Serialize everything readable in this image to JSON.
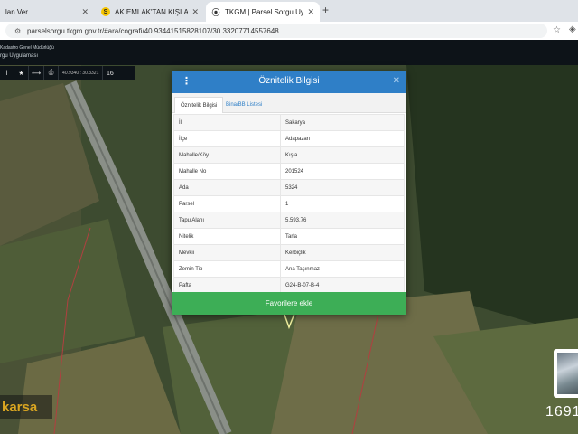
{
  "browser": {
    "tabs": [
      {
        "title": "lan Ver",
        "active": false
      },
      {
        "title": "AK EMLAK'TAN KIŞLA MAH.",
        "active": false
      },
      {
        "title": "TKGM | Parsel Sorgu Uygulam",
        "active": true
      }
    ],
    "url": "parselsorgu.tkgm.gov.tr/#ara/cografi/40.93441515828107/30.33207714557648"
  },
  "app": {
    "org_name": "Kadastro Genel Müdürlüğü",
    "app_name": "rgu Uygulaması"
  },
  "toolbar": {
    "info": "i",
    "favorite": "★",
    "measure": "⟷",
    "print": "⎙",
    "coords": "40.9340 : 30.3321",
    "zoom": "16"
  },
  "modal": {
    "title": "Öznitelik Bilgisi",
    "tabs": [
      "Öznitelik Bilgisi",
      "Bina/BB Listesi"
    ],
    "rows": [
      {
        "key": "İl",
        "value": "Sakarya"
      },
      {
        "key": "İlçe",
        "value": "Adapazarı"
      },
      {
        "key": "Mahalle/Köy",
        "value": "Kışla"
      },
      {
        "key": "Mahalle No",
        "value": "201524"
      },
      {
        "key": "Ada",
        "value": "5324"
      },
      {
        "key": "Parsel",
        "value": "1"
      },
      {
        "key": "Tapu Alanı",
        "value": "5.593,76"
      },
      {
        "key": "Nitelik",
        "value": "Tarla"
      },
      {
        "key": "Mevkii",
        "value": "Kerbiçlik"
      },
      {
        "key": "Zemin Tip",
        "value": "Ana Taşınmaz"
      },
      {
        "key": "Pafta",
        "value": "G24-B-07-B-4"
      }
    ],
    "favorite_button": "Favorilere ekle"
  },
  "map": {
    "logo_text": "karsa",
    "corner_number": "1691"
  }
}
